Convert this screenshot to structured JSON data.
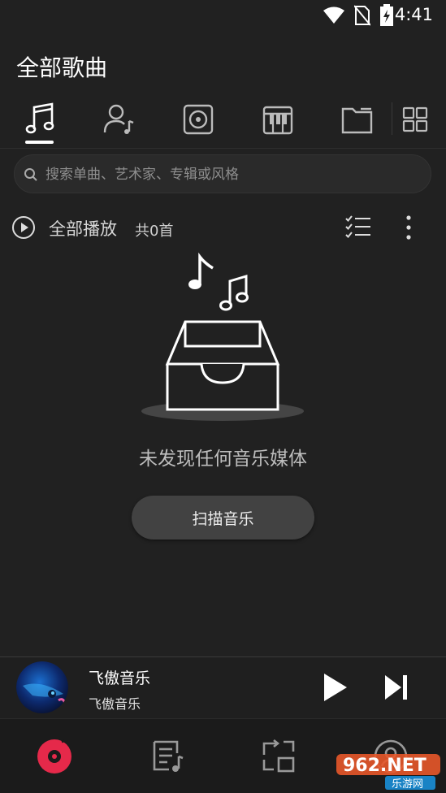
{
  "status_bar": {
    "time": "4:41"
  },
  "header": {
    "title": "全部歌曲"
  },
  "tabs": [
    {
      "name": "songs",
      "icon": "music-note-icon",
      "active": true
    },
    {
      "name": "artists",
      "icon": "artist-icon"
    },
    {
      "name": "albums",
      "icon": "album-disc-icon"
    },
    {
      "name": "genres",
      "icon": "piano-icon"
    },
    {
      "name": "folders",
      "icon": "folder-icon"
    },
    {
      "name": "more",
      "icon": "grid-icon"
    }
  ],
  "search": {
    "placeholder": "搜索单曲、艺术家、专辑或风格"
  },
  "play_all": {
    "label": "全部播放",
    "count": "共0首"
  },
  "empty_state": {
    "message": "未发现任何音乐媒体",
    "scan_button": "扫描音乐"
  },
  "player": {
    "title": "飞傲音乐",
    "artist": "飞傲音乐"
  },
  "bottom_nav": [
    {
      "name": "music",
      "icon": "record-icon",
      "active_color": "#e5294a"
    },
    {
      "name": "playlist",
      "icon": "playlist-icon"
    },
    {
      "name": "transfer",
      "icon": "transfer-icon"
    },
    {
      "name": "profile",
      "icon": "profile-icon"
    }
  ],
  "watermark": {
    "brand": "962.NET",
    "sub": "乐游网"
  },
  "colors": {
    "background": "#212121",
    "accent": "#e5294a"
  }
}
